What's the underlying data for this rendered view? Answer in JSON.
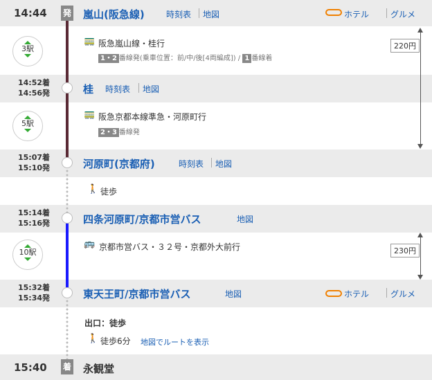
{
  "dep": {
    "time": "14:44",
    "badge": "発",
    "station": "嵐山(阪急線)",
    "timetable": "時刻表",
    "map": "地図",
    "hotel": "ホテル",
    "gourmet": "グルメ"
  },
  "seg1": {
    "stops": "3駅",
    "route": "阪急嵐山線・桂行",
    "platform_box": "1・2",
    "platform_text": "番線発(乗車位置：前/中/後[4両編成]) /",
    "platform_box2": "1",
    "platform_text2": "番線着",
    "fare": "220円"
  },
  "st2": {
    "arr": "14:52着",
    "dep": "14:56発",
    "station": "桂",
    "timetable": "時刻表",
    "map": "地図"
  },
  "seg2": {
    "stops": "5駅",
    "route": "阪急京都本線準急・河原町行",
    "platform_box": "2・3",
    "platform_text": "番線発"
  },
  "st3": {
    "arr": "15:07着",
    "dep": "15:10発",
    "station": "河原町(京都府)",
    "timetable": "時刻表",
    "map": "地図"
  },
  "walk1": {
    "label": "徒歩"
  },
  "st4": {
    "arr": "15:14着",
    "dep": "15:16発",
    "station": "四条河原町/京都市営バス",
    "map": "地図"
  },
  "seg3": {
    "stops": "10駅",
    "route": "京都市営バス・３２号・京都外大前行",
    "fare": "230円"
  },
  "st5": {
    "arr": "15:32着",
    "dep": "15:34発",
    "station": "東天王町/京都市営バス",
    "map": "地図",
    "hotel": "ホテル",
    "gourmet": "グルメ"
  },
  "exit": {
    "label": "出口：徒歩",
    "walk": "徒歩6分",
    "route_link": "地図でルートを表示"
  },
  "arr": {
    "time": "15:40",
    "badge": "着",
    "station": "永観堂"
  },
  "colors": {
    "train_line": "#5a2a35",
    "bus_line": "#1a1aff",
    "link": "#1a5fb4"
  }
}
